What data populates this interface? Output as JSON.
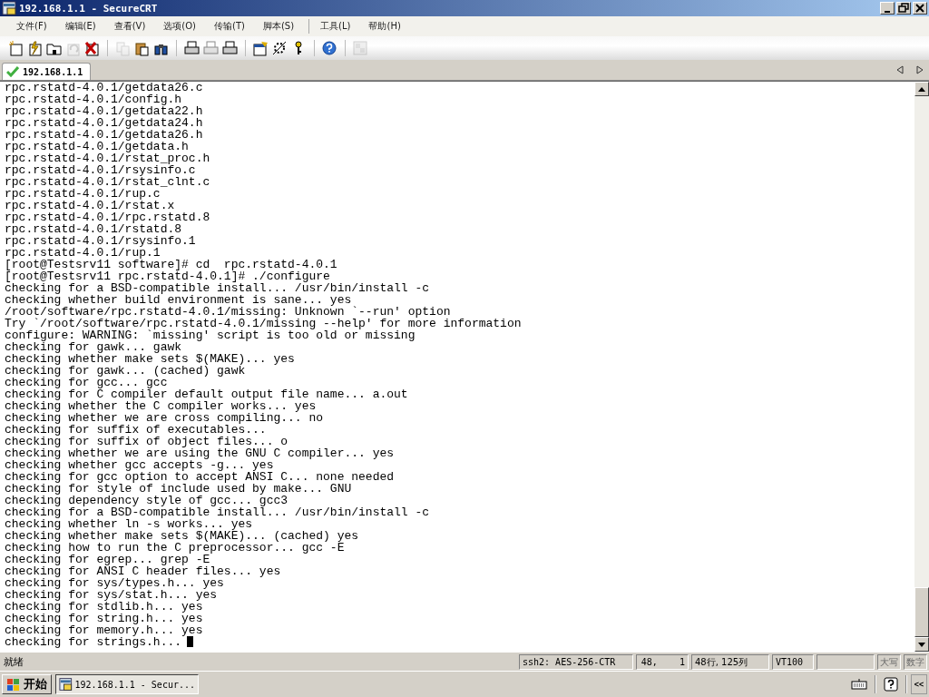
{
  "window": {
    "title": "192.168.1.1 - SecureCRT"
  },
  "menu": [
    "文件(F)",
    "编辑(E)",
    "查看(V)",
    "选项(O)",
    "传输(T)",
    "脚本(S)",
    "工具(L)",
    "帮助(H)"
  ],
  "toolbar": [
    {
      "kind": "new",
      "disabled": false
    },
    {
      "kind": "lightning",
      "disabled": false
    },
    {
      "kind": "tab",
      "disabled": false
    },
    {
      "kind": "reconnect",
      "disabled": true
    },
    {
      "kind": "disconnect",
      "disabled": false
    },
    {
      "kind": "sep"
    },
    {
      "kind": "copy",
      "disabled": true
    },
    {
      "kind": "paste",
      "disabled": false
    },
    {
      "kind": "find",
      "disabled": false
    },
    {
      "kind": "sep"
    },
    {
      "kind": "print",
      "disabled": false
    },
    {
      "kind": "print",
      "disabled": true
    },
    {
      "kind": "print",
      "disabled": false
    },
    {
      "kind": "sep"
    },
    {
      "kind": "options",
      "disabled": false
    },
    {
      "kind": "globe",
      "disabled": false
    },
    {
      "kind": "key",
      "disabled": false
    },
    {
      "kind": "sep"
    },
    {
      "kind": "help",
      "disabled": false
    },
    {
      "kind": "sep"
    },
    {
      "kind": "tile",
      "disabled": true
    }
  ],
  "tabs": [
    {
      "label": "192.168.1.1",
      "selected": true,
      "connected": true
    }
  ],
  "terminal": {
    "cursor": true,
    "lines": [
      "rpc.rstatd-4.0.1/getdata26.c",
      "rpc.rstatd-4.0.1/config.h",
      "rpc.rstatd-4.0.1/getdata22.h",
      "rpc.rstatd-4.0.1/getdata24.h",
      "rpc.rstatd-4.0.1/getdata26.h",
      "rpc.rstatd-4.0.1/getdata.h",
      "rpc.rstatd-4.0.1/rstat_proc.h",
      "rpc.rstatd-4.0.1/rsysinfo.c",
      "rpc.rstatd-4.0.1/rstat_clnt.c",
      "rpc.rstatd-4.0.1/rup.c",
      "rpc.rstatd-4.0.1/rstat.x",
      "rpc.rstatd-4.0.1/rpc.rstatd.8",
      "rpc.rstatd-4.0.1/rstatd.8",
      "rpc.rstatd-4.0.1/rsysinfo.1",
      "rpc.rstatd-4.0.1/rup.1",
      "[root@Testsrv11 software]# cd  rpc.rstatd-4.0.1",
      "[root@Testsrv11 rpc.rstatd-4.0.1]# ./configure",
      "checking for a BSD-compatible install... /usr/bin/install -c",
      "checking whether build environment is sane... yes",
      "/root/software/rpc.rstatd-4.0.1/missing: Unknown `--run' option",
      "Try `/root/software/rpc.rstatd-4.0.1/missing --help' for more information",
      "configure: WARNING: `missing' script is too old or missing",
      "checking for gawk... gawk",
      "checking whether make sets $(MAKE)... yes",
      "checking for gawk... (cached) gawk",
      "checking for gcc... gcc",
      "checking for C compiler default output file name... a.out",
      "checking whether the C compiler works... yes",
      "checking whether we are cross compiling... no",
      "checking for suffix of executables...",
      "checking for suffix of object files... o",
      "checking whether we are using the GNU C compiler... yes",
      "checking whether gcc accepts -g... yes",
      "checking for gcc option to accept ANSI C... none needed",
      "checking for style of include used by make... GNU",
      "checking dependency style of gcc... gcc3",
      "checking for a BSD-compatible install... /usr/bin/install -c",
      "checking whether ln -s works... yes",
      "checking whether make sets $(MAKE)... (cached) yes",
      "checking how to run the C preprocessor... gcc -E",
      "checking for egrep... grep -E",
      "checking for ANSI C header files... yes",
      "checking for sys/types.h... yes",
      "checking for sys/stat.h... yes",
      "checking for stdlib.h... yes",
      "checking for string.h... yes",
      "checking for memory.h... yes",
      "checking for strings.h..."
    ]
  },
  "status_bar": {
    "message": "就绪",
    "fields": [
      {
        "text": "ssh2: AES-256-CTR",
        "disabled": false
      },
      {
        "text": "48,    1",
        "disabled": false
      },
      {
        "text": "48行, 125列",
        "disabled": false
      },
      {
        "text": "VT100",
        "disabled": false
      },
      {
        "text": "大写",
        "disabled": true
      },
      {
        "text": "数字",
        "disabled": true
      }
    ]
  },
  "taskbar": {
    "start": "开始",
    "tasks": [
      {
        "label": "192.168.1.1 - Secur...",
        "selected": true
      }
    ],
    "tray_toggle": "<<"
  }
}
